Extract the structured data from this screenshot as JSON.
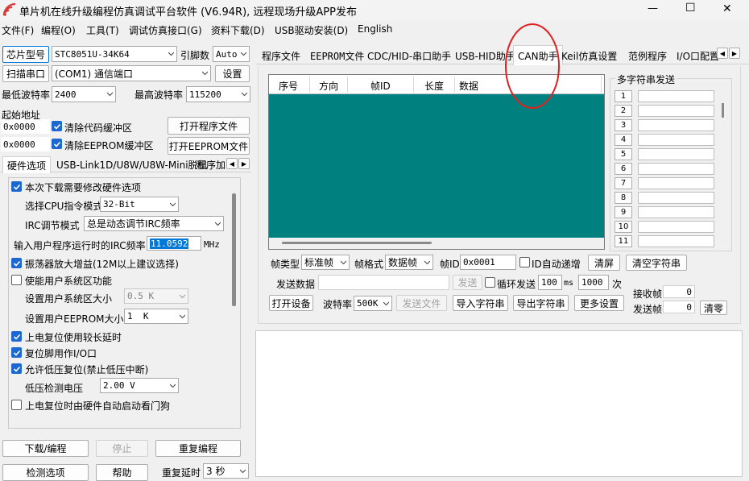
{
  "window": {
    "title": "单片机在线升级编程仿真调试平台软件 (V6.94R), 远程现场升级APP发布",
    "controls": {
      "minimize": "—",
      "maximize": "☐",
      "close": "✕"
    }
  },
  "menubar": {
    "items": [
      "文件(F)",
      "编程(O)",
      "工具(T)",
      "调试仿真接口(G)",
      "资料下载(D)",
      "USB驱动安装(D)",
      "English"
    ]
  },
  "left": {
    "chip_button": "芯片型号",
    "chip_value": "STC8051U-34K64",
    "pin_label": "引脚数",
    "pin_value": "Auto",
    "scan_button": "扫描串口",
    "port_value": "(COM1) 通信端口",
    "settings_button": "设置",
    "min_baud_label": "最低波特率",
    "min_baud_value": "2400",
    "max_baud_label": "最高波特率",
    "max_baud_value": "115200",
    "start_addr_label": "起始地址",
    "addr1": "0x0000",
    "clear_code_label": "清除代码缓冲区",
    "open_prog_button": "打开程序文件",
    "addr2": "0x0000",
    "clear_eeprom_label": "清除EEPROM缓冲区",
    "open_eeprom_button": "打开EEPROM文件",
    "tabs": [
      "硬件选项",
      "USB-Link1D/U8W/U8W-Mini脱机",
      "程序加"
    ],
    "hw": {
      "modify_label": "本次下载需要修改硬件选项",
      "cpu_mode_label": "选择CPU指令模式",
      "cpu_mode_value": "32-Bit",
      "irc_mode_label": "IRC调节模式",
      "irc_mode_value": "总是动态调节IRC频率",
      "irc_freq_label": "输入用户程序运行时的IRC频率",
      "irc_freq_value": "11.0592",
      "irc_freq_unit": "MHz",
      "osc_label": "振荡器放大增益(12M以上建议选择)",
      "sysarea_label": "使能用户系统区功能",
      "sysarea_size_label": "设置用户系统区大小",
      "sysarea_size_value": "0.5 K",
      "eeprom_size_label": "设置用户EEPROM大小",
      "eeprom_size_value": "1  K",
      "long_delay_label": "上电复位使用较长延时",
      "reset_pin_label": "复位脚用作I/O口",
      "lvr_label": "允许低压复位(禁止低压中断)",
      "lvd_label": "低压检测电压",
      "lvd_value": "2.00 V",
      "wdt_label": "上电复位时由硬件自动启动看门狗"
    },
    "download_button": "下载/编程",
    "stop_button": "停止",
    "reprogram_button": "重复编程",
    "detect_button": "检测选项",
    "help_button": "帮助",
    "repeat_delay_label": "重复延时",
    "repeat_delay_value": "3 秒"
  },
  "right": {
    "tabs": [
      "程序文件",
      "EEPROM文件",
      "CDC/HID-串口助手",
      "USB-HID助手",
      "CAN助手",
      "Keil仿真设置",
      "范例程序",
      "I/O口配置"
    ],
    "active_tab": "CAN助手",
    "table_headers": [
      "序号",
      "方向",
      "帧ID",
      "长度",
      "数据"
    ],
    "multi_label": "多字符串发送",
    "multi_numbers": [
      "1",
      "2",
      "3",
      "4",
      "5",
      "6",
      "7",
      "8",
      "9",
      "10",
      "11"
    ],
    "frame_type_label": "帧类型",
    "frame_type_value": "标准帧",
    "frame_format_label": "帧格式",
    "frame_format_value": "数据帧",
    "frame_id_label": "帧ID",
    "frame_id_value": "0x0001",
    "id_auto_label": "ID自动递增",
    "clear_screen_button": "清屏",
    "clear_string_button": "清空字符串",
    "send_data_label": "发送数据",
    "send_button": "发送",
    "loop_label": "循环发送",
    "loop_interval": "100",
    "loop_unit": "ms",
    "loop_count": "1000",
    "loop_count_unit": "次",
    "recv_label": "接收帧",
    "recv_value": "0",
    "open_device_button": "打开设备",
    "baud_label": "波特率",
    "baud_value": "500K",
    "send_file_button": "发送文件",
    "import_button": "导入字符串",
    "export_button": "导出字符串",
    "more_button": "更多设置",
    "sent_label": "发送帧",
    "sent_value": "0",
    "zero_button": "清零"
  },
  "colors": {
    "can_table_bg": "#00807f",
    "highlight_circle": "#e02020",
    "selection": "#0078d7"
  }
}
